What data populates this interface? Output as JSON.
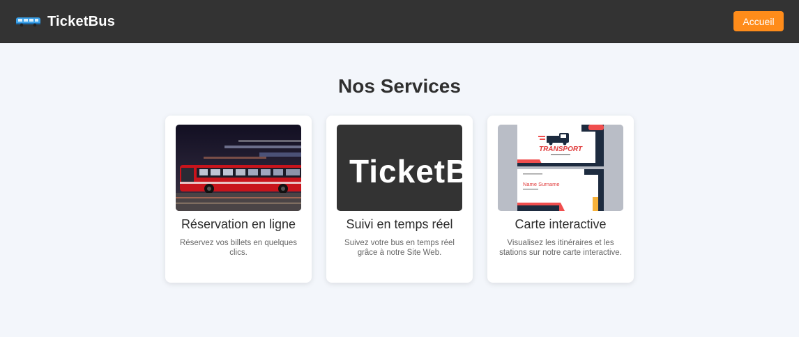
{
  "header": {
    "brand": "TicketBus",
    "home_button": "Accueil"
  },
  "section": {
    "title": "Nos Services"
  },
  "services": [
    {
      "title": "Réservation en ligne",
      "description": "Réservez vos billets en quelques clics.",
      "image": "night-bus-photo"
    },
    {
      "title": "Suivi en temps réel",
      "description": "Suivez votre bus en temps réel grâce à notre Site Web.",
      "image": "ticketbus-logo-banner",
      "image_text": "TicketB"
    },
    {
      "title": "Carte interactive",
      "description": "Visualisez les itinéraires et les stations sur notre carte interactive.",
      "image": "transport-business-cards",
      "image_text": {
        "brand": "TRANSPORT",
        "name": "Name Surname"
      }
    }
  ],
  "colors": {
    "header_bg": "#333333",
    "accent": "#ff8c1a",
    "page_bg": "#f3f6fb"
  }
}
